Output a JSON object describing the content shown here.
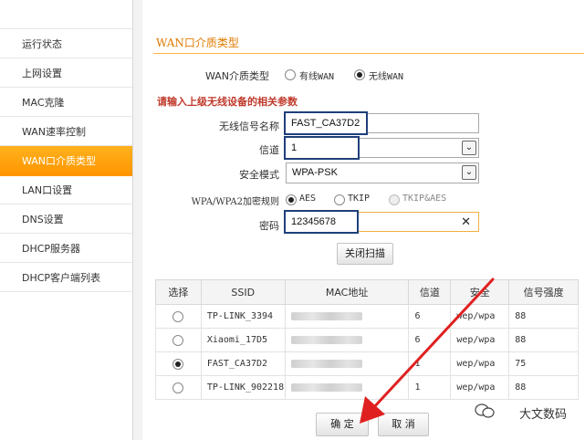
{
  "sidebar": {
    "items": [
      {
        "label": "运行状态",
        "active": false
      },
      {
        "label": "上网设置",
        "active": false
      },
      {
        "label": "MAC克隆",
        "active": false
      },
      {
        "label": "WAN速率控制",
        "active": false
      },
      {
        "label": "WAN口介质类型",
        "active": true
      },
      {
        "label": "LAN口设置",
        "active": false
      },
      {
        "label": "DNS设置",
        "active": false
      },
      {
        "label": "DHCP服务器",
        "active": false
      },
      {
        "label": "DHCP客户端列表",
        "active": false
      }
    ],
    "active_color": "#ff9f12"
  },
  "page_title": "WAN口介质类型",
  "wan_medium": {
    "label": "WAN介质类型",
    "options": [
      "有线WAN",
      "无线WAN"
    ],
    "selected": "无线WAN"
  },
  "hint": "请输入上级无线设备的相关参数",
  "fields": {
    "ssid_label": "无线信号名称",
    "ssid_value": "FAST_CA37D2",
    "channel_label": "信道",
    "channel_value": "1",
    "security_label": "安全模式",
    "security_value": "WPA-PSK",
    "cipher_label": "WPA/WPA2加密规则",
    "cipher_options": [
      "AES",
      "TKIP",
      "TKIP&AES"
    ],
    "cipher_selected": "AES",
    "password_label": "密码",
    "password_value": "12345678"
  },
  "scan_button": "关闭扫描",
  "table": {
    "headers": [
      "选择",
      "SSID",
      "MAC地址",
      "信道",
      "安全",
      "信号强度"
    ],
    "rows": [
      {
        "selected": false,
        "ssid": "TP-LINK_3394",
        "channel": "6",
        "security": "wep/wpa",
        "signal": "88"
      },
      {
        "selected": false,
        "ssid": "Xiaomi_17D5",
        "channel": "6",
        "security": "wep/wpa",
        "signal": "88"
      },
      {
        "selected": true,
        "ssid": "FAST_CA37D2",
        "channel": "1",
        "security": "wep/wpa",
        "signal": "75"
      },
      {
        "selected": false,
        "ssid": "TP-LINK_902218",
        "channel": "1",
        "security": "wep/wpa",
        "signal": "88"
      }
    ]
  },
  "buttons": {
    "ok": "确 定",
    "cancel": "取 消"
  },
  "watermark": "大文数码",
  "colors": {
    "accent_orange": "#ff9f12",
    "highlight_box": "#1f3f7a",
    "arrow_red": "#e02020",
    "hint_red": "#c0392b"
  }
}
